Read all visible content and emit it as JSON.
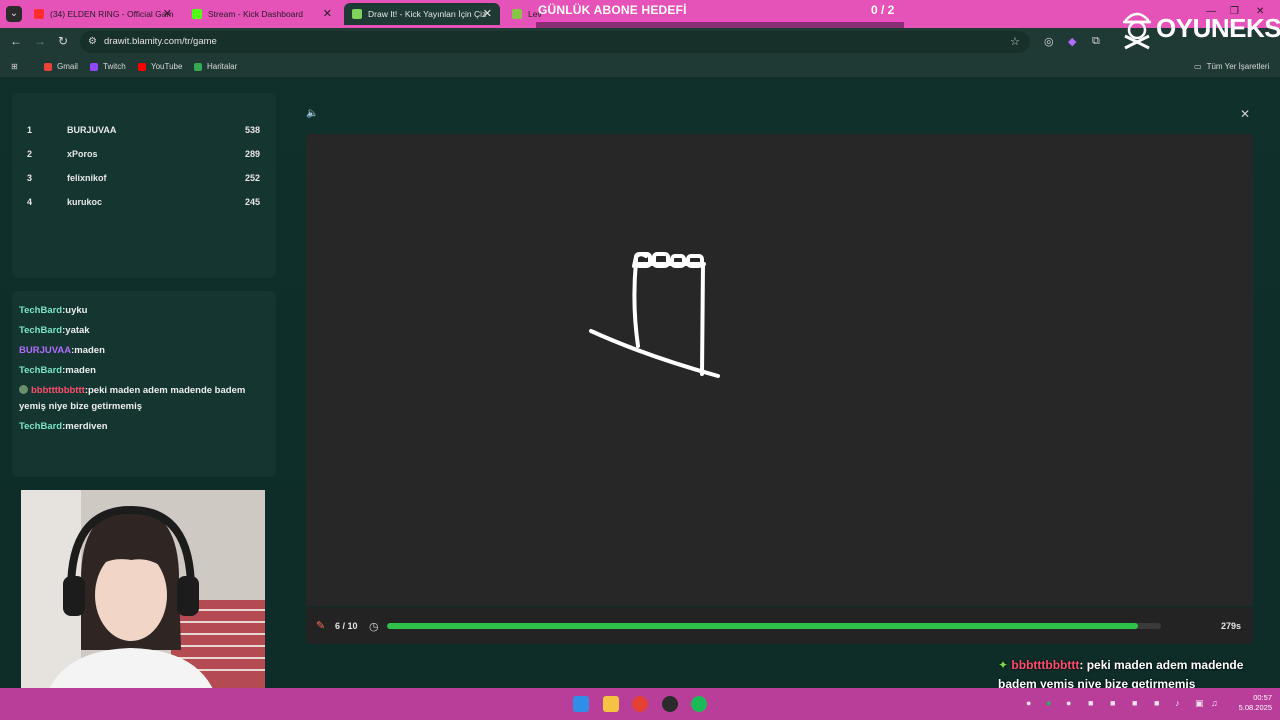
{
  "browser": {
    "tabs": [
      {
        "label": "(34) ELDEN RING - Official Gam",
        "favicon_color": "#ff2d2d"
      },
      {
        "label": "Stream - Kick Dashboard",
        "favicon_color": "#53fc18"
      },
      {
        "label": "Draw It! - Kick Yayınları İçin Çiz",
        "favicon_color": "#7fd35c"
      },
      {
        "label": "Lev",
        "favicon_color": "#8bc34a"
      }
    ],
    "url": "drawit.blamity.com/tr/game",
    "bookmarks": [
      {
        "label": "Gmail",
        "color": "#ea4335"
      },
      {
        "label": "Twitch",
        "color": "#9146ff"
      },
      {
        "label": "YouTube",
        "color": "#ff0000"
      },
      {
        "label": "Haritalar",
        "color": "#34a853"
      }
    ],
    "all_bookmarks": "Tüm Yer İşaretleri"
  },
  "overlay": {
    "goal_title": "GÜNLÜK ABONE HEDEFİ",
    "goal_count": "0 / 2",
    "brand": "OYUNEKS",
    "chat_user": "bbbtttbbbttt",
    "chat_text": ": peki maden adem madende badem yemiş niye bize getirmemiş"
  },
  "leaderboard": [
    {
      "rank": "1",
      "name": "BURJUVAA",
      "score": "538"
    },
    {
      "rank": "2",
      "name": "xPoros",
      "score": "289"
    },
    {
      "rank": "3",
      "name": "felixnikof",
      "score": "252"
    },
    {
      "rank": "4",
      "name": "kurukoc",
      "score": "245"
    }
  ],
  "chat": [
    {
      "user": "TechBard",
      "color": "#7de3c8",
      "text": ":uyku"
    },
    {
      "user": "TechBard",
      "color": "#7de3c8",
      "text": ":yatak"
    },
    {
      "user": "BURJUVAA",
      "color": "#b06cff",
      "text": ":maden"
    },
    {
      "user": "TechBard",
      "color": "#7de3c8",
      "text": ":maden"
    },
    {
      "user": "bbbtttbbbttt",
      "color": "#ff4d6d",
      "text": ":peki maden adem madende badem yemiş niye bize getirmemiş"
    },
    {
      "user": "TechBard",
      "color": "#7de3c8",
      "text": ":merdiven"
    }
  ],
  "game": {
    "round": "6 / 10",
    "time_left": "279s",
    "progress_fraction": 0.97,
    "accent": "#2ec24a"
  },
  "clock": {
    "time": "00:57",
    "date": "5.08.2025"
  }
}
